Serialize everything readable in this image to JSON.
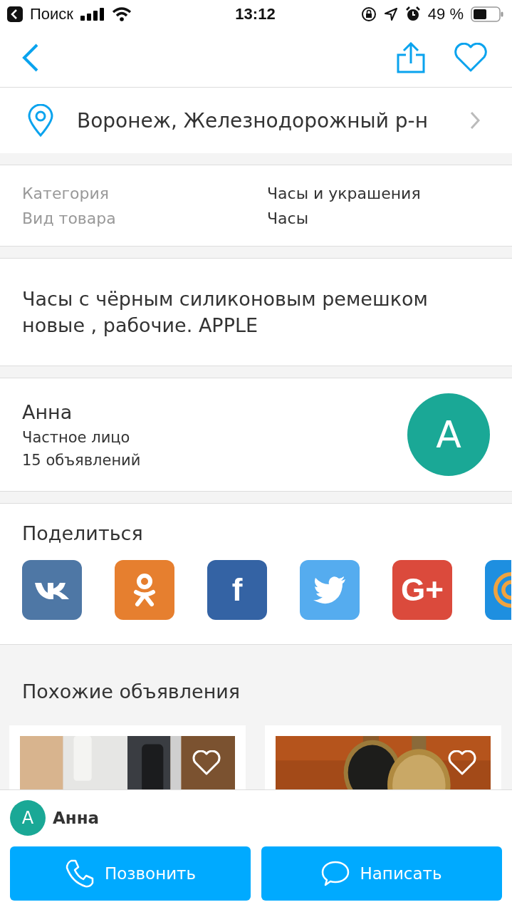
{
  "status_bar": {
    "back_label": "Поиск",
    "time": "13:12",
    "battery": "49 %"
  },
  "location": "Воронеж, Железнодорожный р-н",
  "details": [
    {
      "label": "Категория",
      "value": "Часы и украшения"
    },
    {
      "label": "Вид товара",
      "value": "Часы"
    }
  ],
  "description": "Часы с чёрным силиконовым ремешком новые , рабочие. APPLE",
  "seller": {
    "name": "Анна",
    "type": "Частное лицо",
    "ads": "15 объявлений",
    "initial": "А"
  },
  "share": {
    "title": "Поделиться",
    "items": [
      {
        "kind": "vk",
        "color": "#4e77a5"
      },
      {
        "kind": "ok",
        "color": "#e67f2f"
      },
      {
        "kind": "facebook",
        "color": "#3463a4",
        "glyph": "f"
      },
      {
        "kind": "twitter",
        "color": "#55acef"
      },
      {
        "kind": "gplus",
        "color": "#db4a3c",
        "glyph": "G+"
      },
      {
        "kind": "other",
        "color": "#1e8fe0"
      }
    ]
  },
  "similar": {
    "title": "Похожие объявления",
    "items": [
      {
        "favorite": false
      },
      {
        "favorite": false
      }
    ]
  },
  "contact_bar": {
    "initial": "А",
    "name": "Анна",
    "buttons": [
      {
        "kind": "call",
        "label": "Позвонить"
      },
      {
        "kind": "message",
        "label": "Написать"
      }
    ]
  }
}
